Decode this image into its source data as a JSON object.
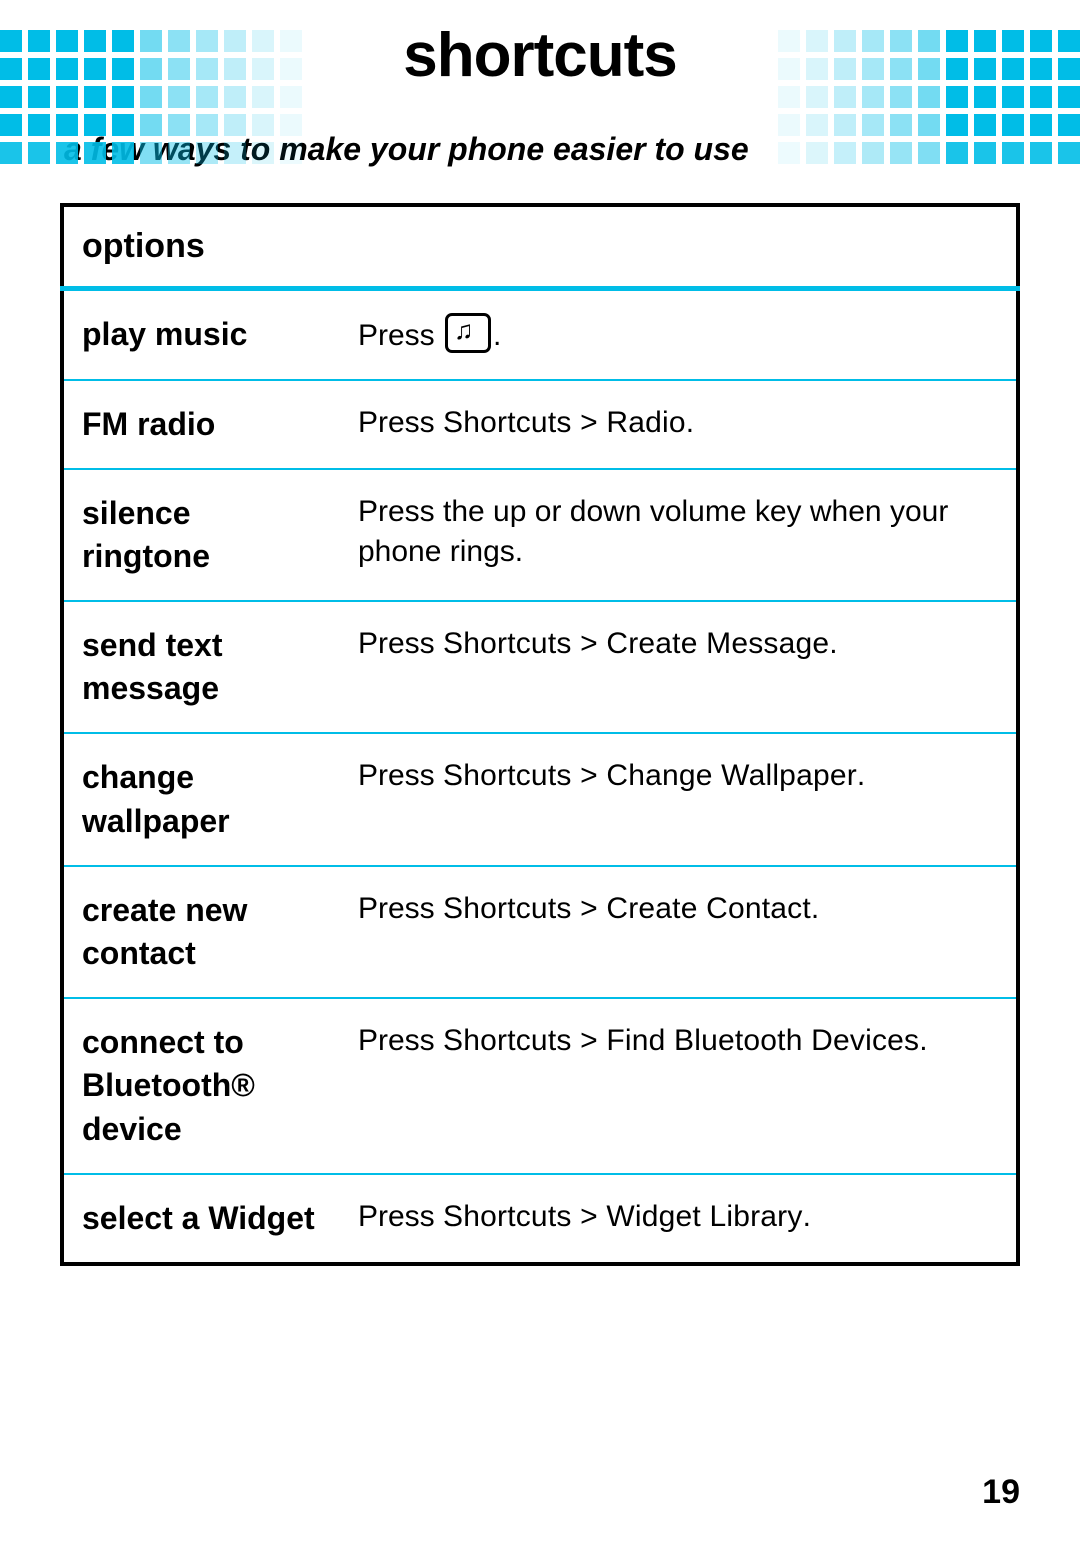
{
  "title": "shortcuts",
  "subtitle": "a few ways to make your phone easier to use",
  "table": {
    "header": "options",
    "rows": [
      {
        "label": "play music",
        "prefix": "Press ",
        "icon": "music-note-icon",
        "suffix": "."
      },
      {
        "label": "FM radio",
        "prefix": "Press ",
        "path": "Shortcuts > Radio",
        "suffix": "."
      },
      {
        "label": "silence ringtone",
        "text": "Press the up or down volume key when your phone rings."
      },
      {
        "label": "send text message",
        "prefix": "Press ",
        "path": "Shortcuts > Create Message",
        "suffix": "."
      },
      {
        "label": "change wallpaper",
        "prefix": "Press ",
        "path": "Shortcuts > Change Wallpaper",
        "suffix": "."
      },
      {
        "label": "create new contact",
        "prefix": "Press ",
        "path": "Shortcuts > Create Contact",
        "suffix": "."
      },
      {
        "label": "connect to Bluetooth® device",
        "prefix": "Press ",
        "path": "Shortcuts > Find Bluetooth Devices",
        "suffix": "."
      },
      {
        "label": "select a Widget",
        "prefix": "Press ",
        "path": "Shortcuts > Widget Library",
        "suffix": "."
      }
    ]
  },
  "page_number": "19"
}
